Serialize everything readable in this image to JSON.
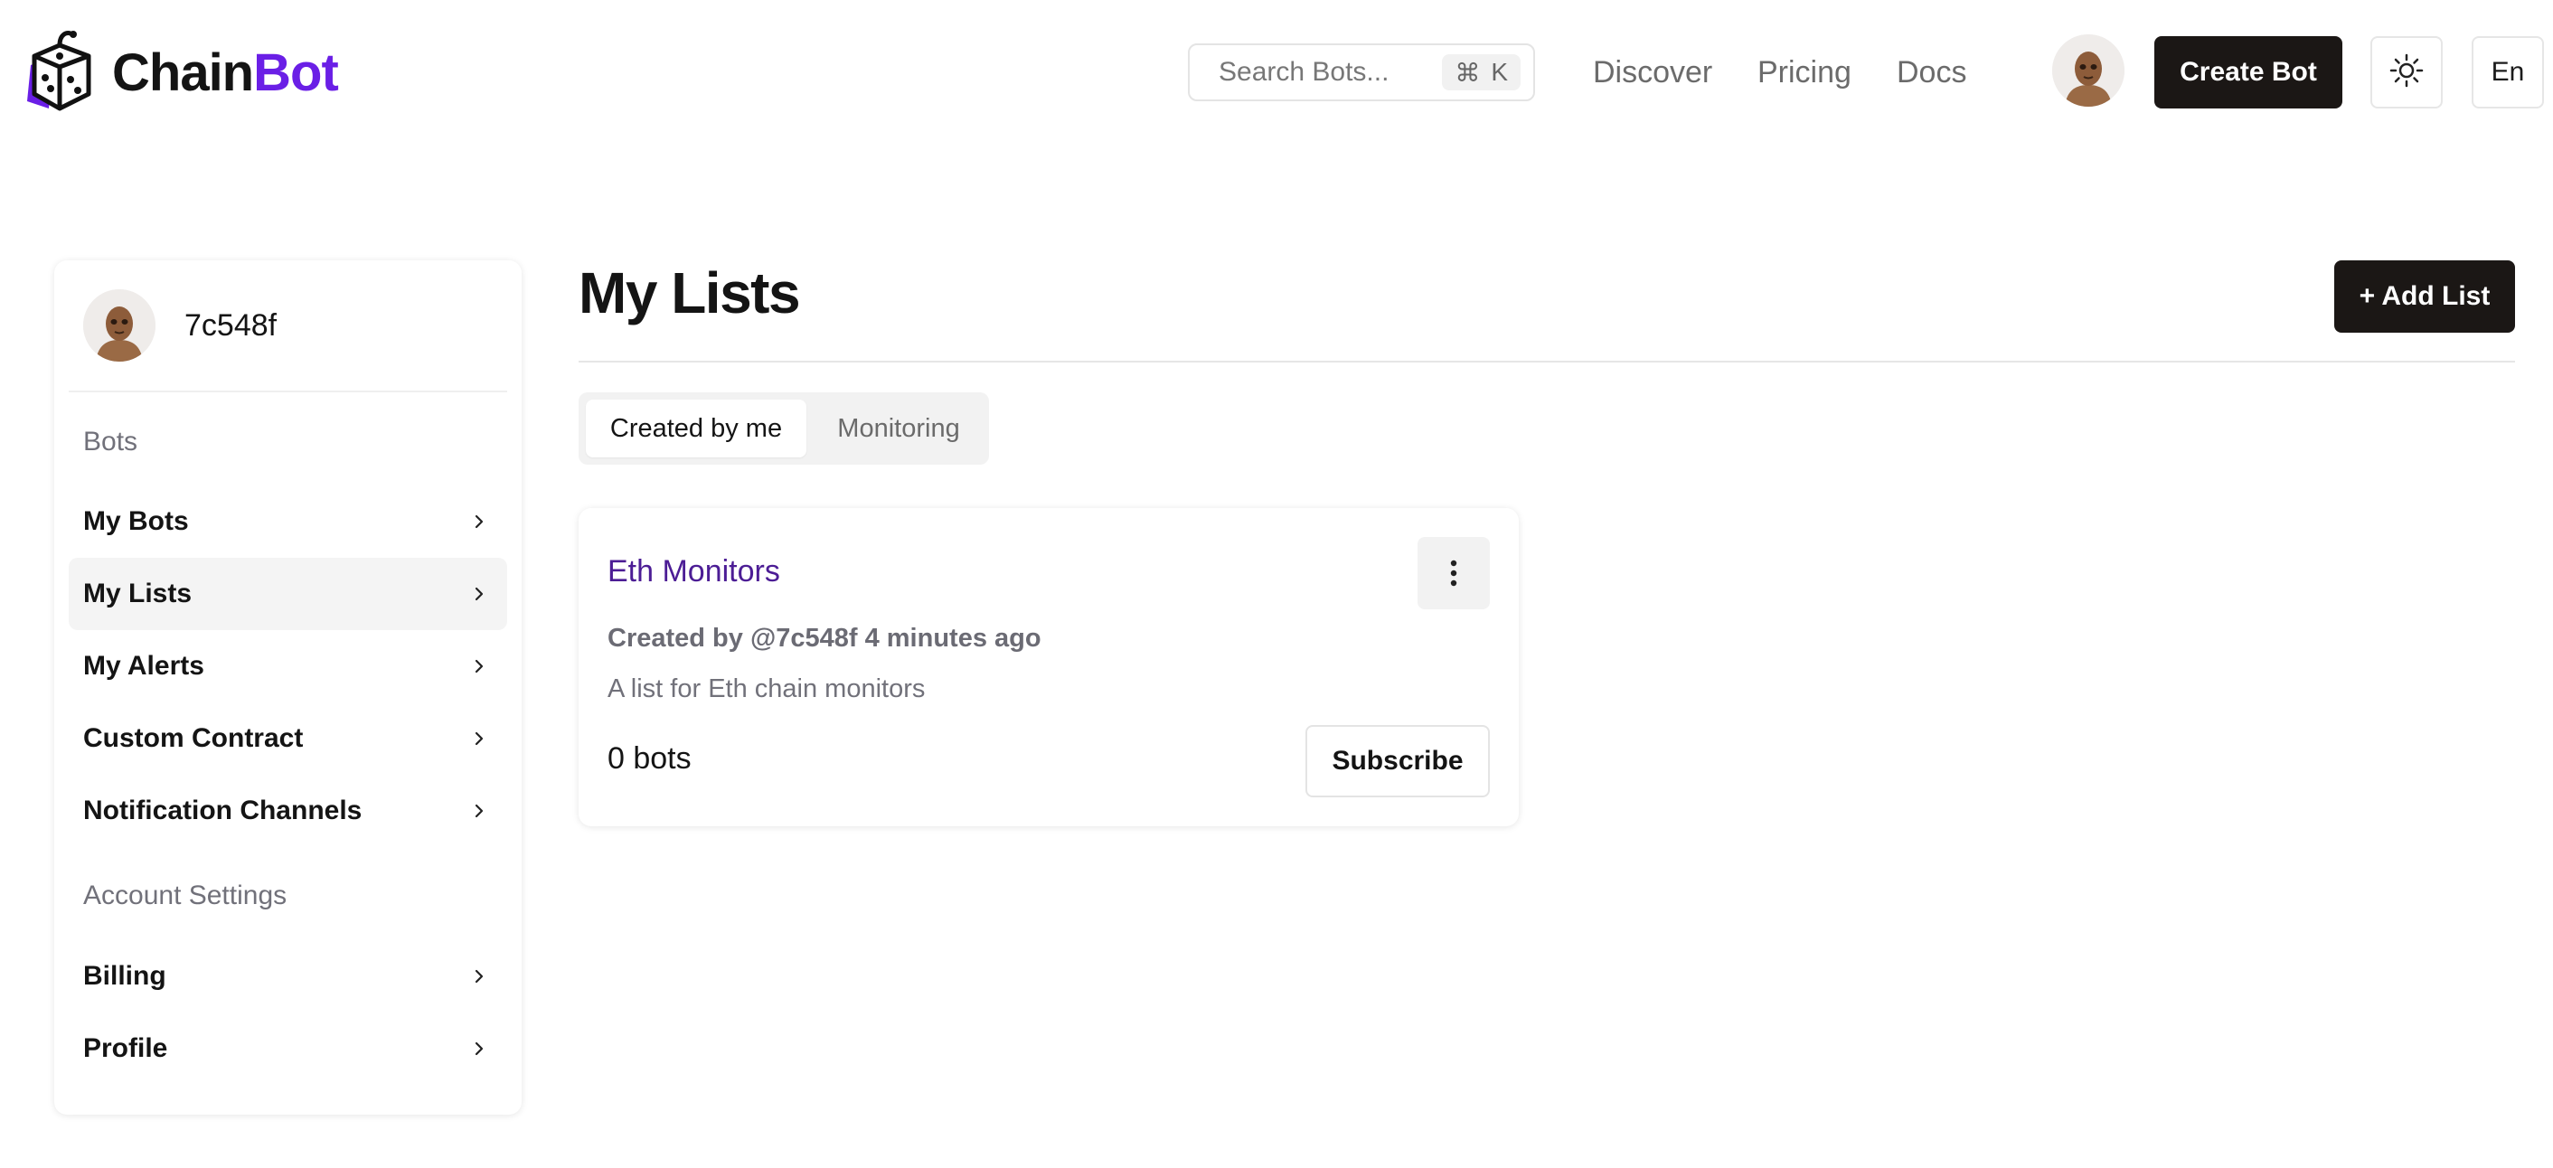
{
  "header": {
    "logo": {
      "text_main": "Chain",
      "text_accent": "Bot",
      "icon": "dice-cube-icon",
      "accent_color": "#6a1fe6"
    },
    "search": {
      "placeholder": "Search Bots...",
      "shortcut_symbol": "⌘",
      "shortcut_key": "K"
    },
    "nav": [
      "Discover",
      "Pricing",
      "Docs"
    ],
    "create_bot_label": "Create Bot",
    "theme_icon": "sun-icon",
    "language": "En"
  },
  "sidebar": {
    "username": "7c548f",
    "sections": [
      {
        "label": "Bots",
        "items": [
          "My Bots",
          "My Lists",
          "My Alerts",
          "Custom Contract",
          "Notification Channels"
        ]
      },
      {
        "label": "Account Settings",
        "items": [
          "Billing",
          "Profile"
        ]
      }
    ],
    "active_item": "My Lists"
  },
  "main": {
    "title": "My Lists",
    "add_button": "+ Add List",
    "tabs": [
      {
        "label": "Created by me",
        "active": true
      },
      {
        "label": "Monitoring",
        "active": false
      }
    ],
    "lists": [
      {
        "title": "Eth Monitors",
        "meta": "Created by @7c548f 4 minutes ago",
        "description": "A list for Eth chain monitors",
        "count": "0 bots",
        "subscribe_label": "Subscribe"
      }
    ]
  },
  "colors": {
    "accent": "#6a1fe6",
    "link": "#4c1d95",
    "dark_button": "#1b1715"
  }
}
